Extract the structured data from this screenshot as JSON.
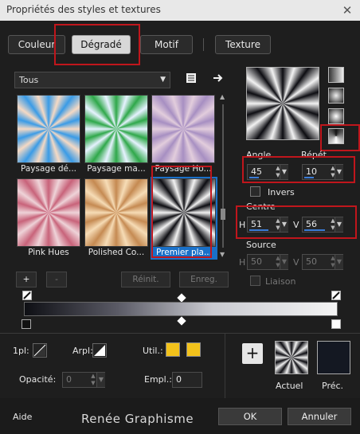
{
  "window": {
    "title": "Propriétés des styles et textures",
    "close_glyph": "✕"
  },
  "tabs": [
    {
      "label": "Couleur"
    },
    {
      "label": "Dégradé"
    },
    {
      "label": "Motif"
    },
    {
      "label": "Texture"
    }
  ],
  "preset_dropdown": {
    "value": "Tous"
  },
  "gradients": [
    {
      "label": "Paysage dé...",
      "colors": [
        "#3a9be6",
        "#f5d9c4"
      ]
    },
    {
      "label": "Paysage ma...",
      "colors": [
        "#2fa84a",
        "#e6f2ff"
      ]
    },
    {
      "label": "Paysage Ho...",
      "colors": [
        "#a78fc2",
        "#e2cddc"
      ]
    },
    {
      "label": "Pink Hues",
      "colors": [
        "#c8637a",
        "#eed3d8"
      ]
    },
    {
      "label": "Polished Co...",
      "colors": [
        "#c58a52",
        "#f6dcb6"
      ]
    },
    {
      "label": "Premier pla...",
      "colors": [
        "#0d0d12",
        "#f2f2f2"
      ]
    }
  ],
  "list_buttons": {
    "add": "+",
    "remove": "-",
    "reset": "Réinit.",
    "save": "Enreg."
  },
  "params": {
    "angle_label": "Angle",
    "angle": "45",
    "repeat_label": "Répét",
    "repeat": "10",
    "invert_label": "Invers",
    "center_label": "Centre",
    "center_h_label": "H",
    "center_h": "51",
    "center_v_label": "V",
    "center_v": "56",
    "source_label": "Source",
    "source_h_label": "H",
    "source_h": "50",
    "source_v_label": "V",
    "source_v": "50",
    "link_label": "Liaison"
  },
  "bottom": {
    "first_plane_label": "1pl:",
    "arpl_label": "Arpl:",
    "util_label": "Util.:",
    "opacity_label": "Opacité:",
    "opacity": "0",
    "empl_label": "Empl.:",
    "empl": "0",
    "add_glyph": "+",
    "current_label": "Actuel",
    "previous_label": "Préc.",
    "util_colors": [
      "#f2c21b",
      "#f2c21b"
    ],
    "previous_color": "#141822"
  },
  "footer": {
    "help": "Aide",
    "watermark": "Renée Graphisme",
    "ok": "OK",
    "cancel": "Annuler"
  },
  "accent_color": "#3a7bd5",
  "highlight_color": "#c0161c"
}
